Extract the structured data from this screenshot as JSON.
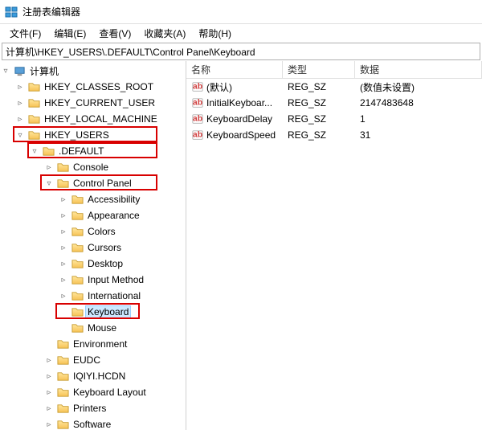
{
  "window": {
    "title": "注册表编辑器"
  },
  "menu": {
    "file": "文件(F)",
    "edit": "编辑(E)",
    "view": "查看(V)",
    "favorites": "收藏夹(A)",
    "help": "帮助(H)"
  },
  "address": "计算机\\HKEY_USERS\\.DEFAULT\\Control Panel\\Keyboard",
  "columns": {
    "name": "名称",
    "type": "类型",
    "data": "数据"
  },
  "values": [
    {
      "name": "(默认)",
      "type": "REG_SZ",
      "data": "(数值未设置)"
    },
    {
      "name": "InitialKeyboar...",
      "type": "REG_SZ",
      "data": "2147483648"
    },
    {
      "name": "KeyboardDelay",
      "type": "REG_SZ",
      "data": "1"
    },
    {
      "name": "KeyboardSpeed",
      "type": "REG_SZ",
      "data": "31"
    }
  ],
  "tree": {
    "root": "计算机",
    "hives": {
      "hkcr": "HKEY_CLASSES_ROOT",
      "hkcu": "HKEY_CURRENT_USER",
      "hklm": "HKEY_LOCAL_MACHINE",
      "hku": "HKEY_USERS"
    },
    "default": ".DEFAULT",
    "default_children": {
      "console": "Console",
      "cpl": "Control Panel",
      "env": "Environment",
      "eudc": "EUDC",
      "iqiyi": "IQIYI.HCDN",
      "kblayout": "Keyboard Layout",
      "printers": "Printers",
      "software": "Software"
    },
    "cpl_children": {
      "accessibility": "Accessibility",
      "appearance": "Appearance",
      "colors": "Colors",
      "cursors": "Cursors",
      "desktop": "Desktop",
      "inputmethod": "Input Method",
      "international": "International",
      "keyboard": "Keyboard",
      "mouse": "Mouse"
    }
  }
}
